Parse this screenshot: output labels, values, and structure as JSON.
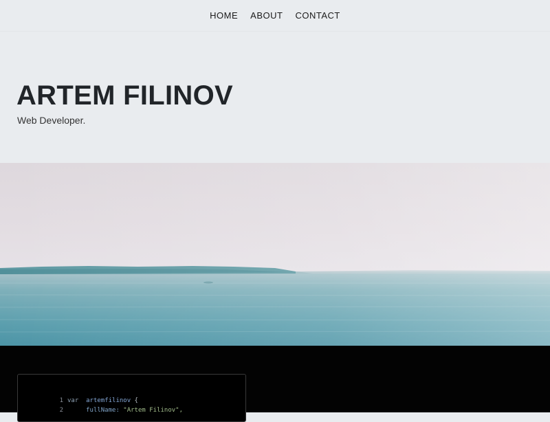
{
  "nav": {
    "items": [
      {
        "label": "HOME"
      },
      {
        "label": "ABOUT"
      },
      {
        "label": "CONTACT"
      }
    ]
  },
  "hero": {
    "title": "ARTEM FILINOV",
    "subtitle": "Web Developer."
  },
  "photo": {
    "description_icon": "sea-landscape-image"
  },
  "code": {
    "lines": [
      {
        "num": "1",
        "keyword": "var",
        "identifier": "artemfilinov",
        "punct": " {"
      },
      {
        "num": "2",
        "property": "fullName:",
        "string": " \"Artem Filinov\","
      }
    ]
  },
  "colors": {
    "page_bg": "#e9ecef",
    "code_bg": "#030303",
    "title": "#212529"
  }
}
